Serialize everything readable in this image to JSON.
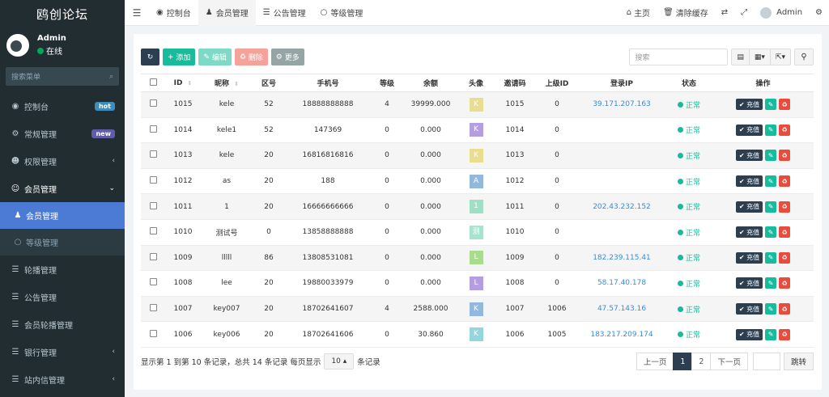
{
  "sidebar": {
    "logo": "鸥创论坛",
    "user": {
      "name": "Admin",
      "status": "在线"
    },
    "search_placeholder": "搜索菜单",
    "items": [
      {
        "label": "控制台",
        "icon": "dashboard-icon",
        "badge": "hot",
        "badge_color": "#3c8dbc"
      },
      {
        "label": "常规管理",
        "icon": "cogs-icon",
        "badge": "new",
        "badge_color": "#605ca8"
      },
      {
        "label": "权限管理",
        "icon": "group-icon"
      },
      {
        "label": "会员管理",
        "icon": "user-circle-icon"
      }
    ],
    "sub_items": [
      {
        "label": "会员管理",
        "icon": "user-icon",
        "active": true
      },
      {
        "label": "等级管理",
        "icon": "circle-icon",
        "active": false
      }
    ],
    "items2": [
      {
        "label": "轮播管理",
        "icon": "list-icon"
      },
      {
        "label": "公告管理",
        "icon": "list-icon"
      },
      {
        "label": "会员轮播管理",
        "icon": "list-icon"
      },
      {
        "label": "银行管理",
        "icon": "list-icon"
      },
      {
        "label": "站内信管理",
        "icon": "list-icon"
      }
    ]
  },
  "topbar": {
    "tabs": [
      {
        "label": "控制台",
        "icon": "dashboard-icon"
      },
      {
        "label": "会员管理",
        "icon": "user-icon",
        "active": true
      },
      {
        "label": "公告管理",
        "icon": "list-icon"
      },
      {
        "label": "等级管理",
        "icon": "circle-icon"
      }
    ],
    "home": "主页",
    "clear_cache": "清除缓存",
    "admin": "Admin"
  },
  "toolbar": {
    "add": "添加",
    "edit": "编辑",
    "delete": "删除",
    "more": "更多",
    "search_placeholder": "搜索"
  },
  "table": {
    "headers": [
      "ID",
      "昵称",
      "区号",
      "手机号",
      "等级",
      "余额",
      "头像",
      "邀请码",
      "上级ID",
      "登录IP",
      "状态",
      "操作"
    ],
    "charge_label": "充值",
    "rows": [
      {
        "id": "1015",
        "nick": "kele",
        "area": "52",
        "phone": "18888888888",
        "level": "4",
        "balance": "39999.000",
        "avatar": "K",
        "avatar_color": "#e7df8f",
        "invite": "1015",
        "parent": "0",
        "ip": "39.171.207.163",
        "status": "正常"
      },
      {
        "id": "1014",
        "nick": "kele1",
        "area": "52",
        "phone": "147369",
        "level": "0",
        "balance": "0.000",
        "avatar": "K",
        "avatar_color": "#b29ee0",
        "invite": "1014",
        "parent": "0",
        "ip": "",
        "status": "正常"
      },
      {
        "id": "1013",
        "nick": "kele",
        "area": "20",
        "phone": "16816816816",
        "level": "0",
        "balance": "0.000",
        "avatar": "K",
        "avatar_color": "#e7df8f",
        "invite": "1013",
        "parent": "0",
        "ip": "",
        "status": "正常"
      },
      {
        "id": "1012",
        "nick": "as",
        "area": "20",
        "phone": "188",
        "level": "0",
        "balance": "0.000",
        "avatar": "A",
        "avatar_color": "#93b8dd",
        "invite": "1012",
        "parent": "0",
        "ip": "",
        "status": "正常"
      },
      {
        "id": "1011",
        "nick": "1",
        "area": "20",
        "phone": "16666666666",
        "level": "0",
        "balance": "0.000",
        "avatar": "1",
        "avatar_color": "#9fdfc6",
        "invite": "1011",
        "parent": "0",
        "ip": "202.43.232.152",
        "status": "正常"
      },
      {
        "id": "1010",
        "nick": "测试号",
        "area": "0",
        "phone": "13858888888",
        "level": "0",
        "balance": "0.000",
        "avatar": "测",
        "avatar_color": "#a9e3cf",
        "invite": "1010",
        "parent": "0",
        "ip": "",
        "status": "正常"
      },
      {
        "id": "1009",
        "nick": "lllll",
        "area": "86",
        "phone": "13808531081",
        "level": "0",
        "balance": "0.000",
        "avatar": "L",
        "avatar_color": "#a9dc8f",
        "invite": "1009",
        "parent": "0",
        "ip": "182.239.115.41",
        "status": "正常"
      },
      {
        "id": "1008",
        "nick": "lee",
        "area": "20",
        "phone": "19880033979",
        "level": "0",
        "balance": "0.000",
        "avatar": "L",
        "avatar_color": "#b29ee0",
        "invite": "1008",
        "parent": "0",
        "ip": "58.17.40.178",
        "status": "正常"
      },
      {
        "id": "1007",
        "nick": "key007",
        "area": "20",
        "phone": "18702641607",
        "level": "4",
        "balance": "2588.000",
        "avatar": "K",
        "avatar_color": "#93b8dd",
        "invite": "1007",
        "parent": "1006",
        "ip": "47.57.143.16",
        "status": "正常"
      },
      {
        "id": "1006",
        "nick": "key006",
        "area": "20",
        "phone": "18702641606",
        "level": "0",
        "balance": "30.860",
        "avatar": "K",
        "avatar_color": "#93d6dd",
        "invite": "1006",
        "parent": "1005",
        "ip": "183.217.209.174",
        "status": "正常"
      }
    ]
  },
  "footer": {
    "info_prefix": "显示第 1 到第 10 条记录，总共 14 条记录 每页显示",
    "page_size": "10",
    "info_suffix": "条记录",
    "prev": "上一页",
    "pages": [
      "1",
      "2"
    ],
    "current_page": "1",
    "next": "下一页",
    "jump": "跳转"
  }
}
